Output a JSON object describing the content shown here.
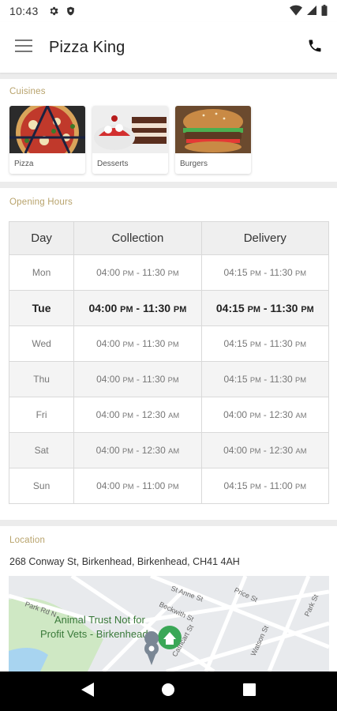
{
  "status_bar": {
    "time": "10:43"
  },
  "app_bar": {
    "title": "Pizza King"
  },
  "cuisines": {
    "title": "Cuisines",
    "items": [
      {
        "label": "Pizza"
      },
      {
        "label": "Desserts"
      },
      {
        "label": "Burgers"
      }
    ]
  },
  "opening_hours": {
    "title": "Opening Hours",
    "headers": {
      "day": "Day",
      "collection": "Collection",
      "delivery": "Delivery"
    },
    "rows": [
      {
        "day": "Mon",
        "c_start": "04:00",
        "c_start_ap": "PM",
        "c_end": "11:30",
        "c_end_ap": "PM",
        "d_start": "04:15",
        "d_start_ap": "PM",
        "d_end": "11:30",
        "d_end_ap": "PM"
      },
      {
        "day": "Tue",
        "c_start": "04:00",
        "c_start_ap": "PM",
        "c_end": "11:30",
        "c_end_ap": "PM",
        "d_start": "04:15",
        "d_start_ap": "PM",
        "d_end": "11:30",
        "d_end_ap": "PM"
      },
      {
        "day": "Wed",
        "c_start": "04:00",
        "c_start_ap": "PM",
        "c_end": "11:30",
        "c_end_ap": "PM",
        "d_start": "04:15",
        "d_start_ap": "PM",
        "d_end": "11:30",
        "d_end_ap": "PM"
      },
      {
        "day": "Thu",
        "c_start": "04:00",
        "c_start_ap": "PM",
        "c_end": "11:30",
        "c_end_ap": "PM",
        "d_start": "04:15",
        "d_start_ap": "PM",
        "d_end": "11:30",
        "d_end_ap": "PM"
      },
      {
        "day": "Fri",
        "c_start": "04:00",
        "c_start_ap": "PM",
        "c_end": "12:30",
        "c_end_ap": "AM",
        "d_start": "04:00",
        "d_start_ap": "PM",
        "d_end": "12:30",
        "d_end_ap": "AM"
      },
      {
        "day": "Sat",
        "c_start": "04:00",
        "c_start_ap": "PM",
        "c_end": "12:30",
        "c_end_ap": "AM",
        "d_start": "04:00",
        "d_start_ap": "PM",
        "d_end": "12:30",
        "d_end_ap": "AM"
      },
      {
        "day": "Sun",
        "c_start": "04:00",
        "c_start_ap": "PM",
        "c_end": "11:00",
        "c_end_ap": "PM",
        "d_start": "04:15",
        "d_start_ap": "PM",
        "d_end": "11:00",
        "d_end_ap": "PM"
      }
    ]
  },
  "location": {
    "title": "Location",
    "address": "268 Conway St, Birkenhead, Birkenhead, CH41 4AH",
    "map": {
      "place_name_line1": "Animal Trust Not for",
      "place_name_line2": "Profit Vets - Birkenhead",
      "streets": [
        "Park Rd N",
        "St Anne St",
        "Price St",
        "Beckwith St",
        "Cathcart St",
        "Watson St",
        "Park St"
      ]
    }
  },
  "colors": {
    "section_title": "#b8a36c",
    "accent_green": "#3aa757"
  }
}
